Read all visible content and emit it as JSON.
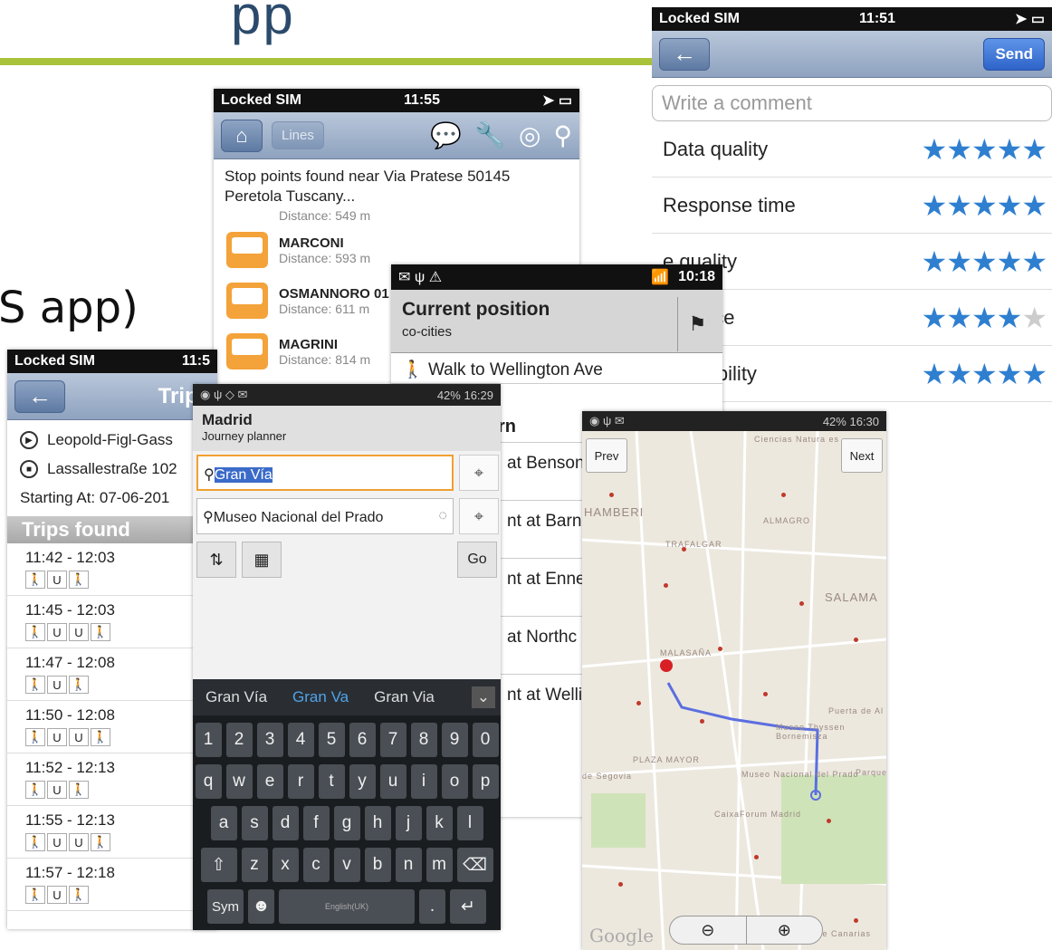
{
  "slide": {
    "title_fragment": "pp",
    "caption_fragment": "S app)"
  },
  "rating_screen": {
    "status": {
      "carrier": "Locked SIM",
      "time": "11:51"
    },
    "send_label": "Send",
    "comment_placeholder": "Write a comment",
    "rows": [
      {
        "label": "Data quality",
        "stars": 5
      },
      {
        "label": "Response time",
        "stars": 5
      },
      {
        "label": "e quality",
        "stars": 5
      },
      {
        "label": "nterface",
        "stars": 4
      },
      {
        "label": "e reliability",
        "stars": 5
      }
    ]
  },
  "stops_screen": {
    "status": {
      "carrier": "Locked SIM",
      "time": "11:55"
    },
    "lines_label": "Lines",
    "header": "Stop points found near Via Pratese 50145 Peretola Tuscany...",
    "partial_distance": "Distance: 549 m",
    "stops": [
      {
        "name": "MARCONI",
        "distance": "Distance: 593 m"
      },
      {
        "name": "OSMANNORO 01",
        "distance": "Distance: 611 m"
      },
      {
        "name": "MAGRINI",
        "distance": "Distance: 814 m"
      }
    ]
  },
  "trips_screen": {
    "status": {
      "carrier": "Locked SIM",
      "time": "11:5"
    },
    "title": "Trips",
    "from": "Leopold-Figl-Gass",
    "to": "Lassallestraße 102",
    "starting": "Starting At:  07-06-201",
    "found_label": "Trips found",
    "trips": [
      {
        "time": "11:42 - 12:03",
        "modes": [
          "walk",
          "u",
          "walk"
        ]
      },
      {
        "time": "11:45 - 12:03",
        "modes": [
          "walk",
          "u",
          "u",
          "walk"
        ]
      },
      {
        "time": "11:47 - 12:08",
        "modes": [
          "walk",
          "u",
          "walk"
        ]
      },
      {
        "time": "11:50 - 12:08",
        "modes": [
          "walk",
          "u",
          "u",
          "walk"
        ]
      },
      {
        "time": "11:52 - 12:13",
        "modes": [
          "walk",
          "u",
          "walk"
        ]
      },
      {
        "time": "11:55 - 12:13",
        "modes": [
          "walk",
          "u",
          "u",
          "walk"
        ]
      },
      {
        "time": "11:57 - 12:18",
        "modes": [
          "walk",
          "u",
          "walk"
        ]
      }
    ]
  },
  "position_screen": {
    "status_time": "10:18",
    "title": "Current position",
    "subtitle": "co-cities",
    "walk": "Walk to Wellington Ave",
    "heading_frag": "rn",
    "steps": [
      "at Benson",
      "nt at Barns",
      "nt at Enner",
      "at Northc",
      "nt at Wellir"
    ]
  },
  "madrid_screen": {
    "status_time": "42% 16:29",
    "title": "Madrid",
    "subtitle": "Journey planner",
    "from_value": "Gran Vía",
    "to_value": "Museo Nacional del Prado",
    "go_label": "Go",
    "suggestions": [
      "Gran Vía",
      "Gran Va",
      "Gran Via"
    ],
    "keys_row1": [
      "1",
      "2",
      "3",
      "4",
      "5",
      "6",
      "7",
      "8",
      "9",
      "0"
    ],
    "keys_row2": [
      "q",
      "w",
      "e",
      "r",
      "t",
      "y",
      "u",
      "i",
      "o",
      "p"
    ],
    "keys_row3": [
      "a",
      "s",
      "d",
      "f",
      "g",
      "h",
      "j",
      "k",
      "l"
    ],
    "keys_row4": [
      "z",
      "x",
      "c",
      "v",
      "b",
      "n",
      "m"
    ],
    "sym_label": "Sym",
    "space_label": "English(UK)"
  },
  "map_screen": {
    "status_time": "42% 16:30",
    "prev_label": "Prev",
    "next_label": "Next",
    "google_label": "Google",
    "labels": [
      "Ciencias Natura es",
      "HAMBERI",
      "ALMAGRO",
      "TRAFALGAR",
      "SALAMA",
      "MALASAÑA",
      "Museo Thyssen Bornemisza",
      "PLAZA MAYOR",
      "Museo Nacional del Prado",
      "CaixaForum Madrid",
      "Puerta de Al",
      "Parque",
      "de Segovia",
      "Calle Canarias"
    ]
  }
}
